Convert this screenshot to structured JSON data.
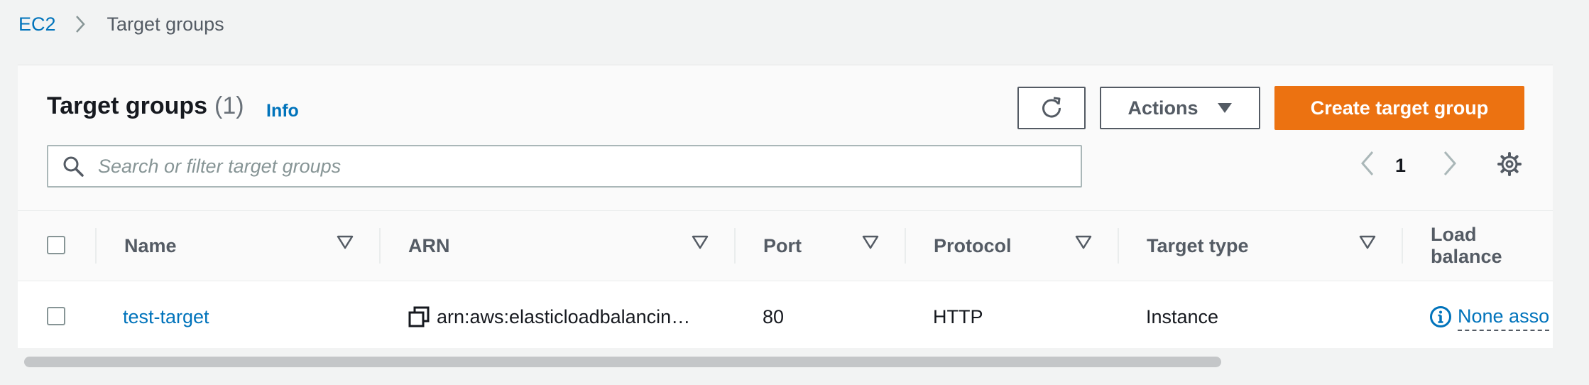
{
  "breadcrumb": {
    "parent": "EC2",
    "current": "Target groups"
  },
  "header": {
    "title": "Target groups",
    "count": "(1)",
    "info": "Info",
    "actions_label": "Actions",
    "create_label": "Create target group"
  },
  "search": {
    "placeholder": "Search or filter target groups",
    "value": ""
  },
  "pagination": {
    "current_page": "1"
  },
  "table": {
    "columns": [
      "Name",
      "ARN",
      "Port",
      "Protocol",
      "Target type",
      "Load balance"
    ],
    "rows": [
      {
        "name": "test-target",
        "arn": "arn:aws:elasticloadbalancin…",
        "port": "80",
        "protocol": "HTTP",
        "target_type": "Instance",
        "load_balancer": "None asso"
      }
    ]
  },
  "colors": {
    "accent": "#ec7211",
    "link": "#0073bb",
    "text": "#16191f",
    "muted": "#545b64"
  },
  "icons": [
    "chevron-right-icon",
    "refresh-icon",
    "caret-down-icon",
    "search-icon",
    "chevron-left-icon",
    "gear-icon",
    "sort-icon",
    "copy-icon",
    "info-icon"
  ]
}
